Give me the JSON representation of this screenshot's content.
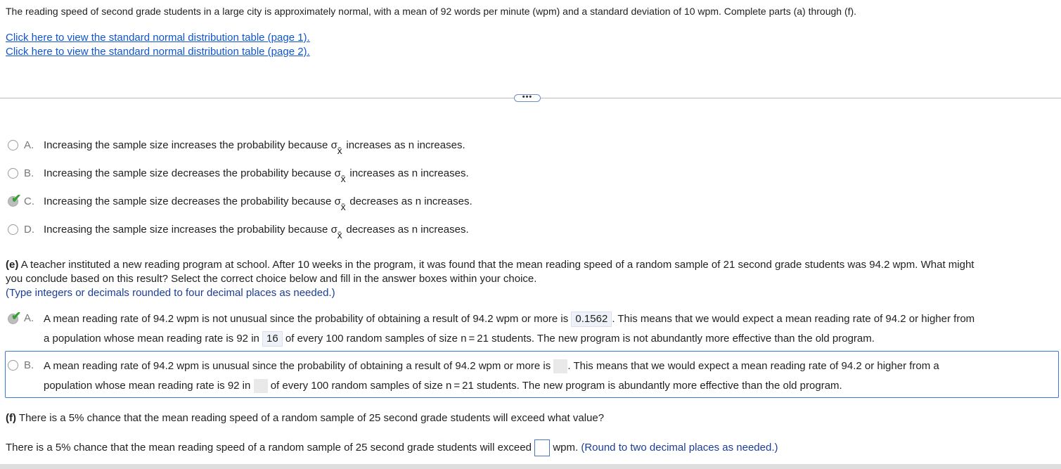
{
  "intro": "The reading speed of second grade students in a large city is approximately normal, with a mean of 92 words per minute (wpm) and a standard deviation of 10 wpm. Complete parts (a) through (f).",
  "links": {
    "table1": "Click here to view the standard normal distribution table (page 1).",
    "table2": "Click here to view the standard normal distribution table (page 2)."
  },
  "more_button": "•••",
  "part_d": {
    "options": [
      {
        "letter": "A.",
        "pre": "Increasing the sample size increases the probability because",
        "post": "increases as n increases."
      },
      {
        "letter": "B.",
        "pre": "Increasing the sample size decreases the probability because",
        "post": "increases as n increases."
      },
      {
        "letter": "C.",
        "pre": "Increasing the sample size decreases the probability because",
        "post": "decreases as n increases."
      },
      {
        "letter": "D.",
        "pre": "Increasing the sample size increases the probability because",
        "post": "decreases as n increases."
      }
    ],
    "sigma": "σ",
    "sigma_sub": "x̄",
    "correct": "C"
  },
  "part_e": {
    "label": "(e)",
    "question_1": "A teacher instituted a new reading program at school. After 10 weeks in the program, it was found that the mean reading speed of a random sample of 21 second grade students was 94.2 wpm. What might",
    "question_2": "you conclude based on this result? Select the correct choice below and fill in the answer boxes within your choice.",
    "hint": "(Type integers or decimals rounded to four decimal places as needed.)",
    "optA": {
      "letter": "A.",
      "l1_pre": "A mean reading rate of 94.2 wpm is not unusual since the probability of obtaining a result of 94.2 wpm or more is",
      "l1_value": "0.1562",
      "l1_post": ". This means that we would expect a mean reading rate of 94.2 or higher from",
      "l2_pre": "a population whose mean reading rate is 92 in",
      "l2_value": "16",
      "l2_post": "of every 100 random samples of size n = 21 students. The new program is not abundantly more effective than the old program."
    },
    "optB": {
      "letter": "B.",
      "l1_pre": "A mean reading rate of 94.2 wpm is unusual since the probability of obtaining a result of 94.2 wpm or more is",
      "l1_post": ". This means that we would expect a mean reading rate of 94.2 or higher from a",
      "l2_pre": "population whose mean reading rate is 92 in",
      "l2_post": "of every 100 random samples of size n = 21 students. The new program is abundantly more effective than the old program."
    }
  },
  "part_f": {
    "label": "(f)",
    "question": "There is a 5% chance that the mean reading speed of a random sample of 25 second grade students will exceed what value?",
    "answer_pre": "There is a 5% chance that the mean reading speed of a random sample of 25 second grade students will exceed",
    "answer_unit": "wpm.",
    "hint": "(Round to two decimal places as needed.)"
  }
}
